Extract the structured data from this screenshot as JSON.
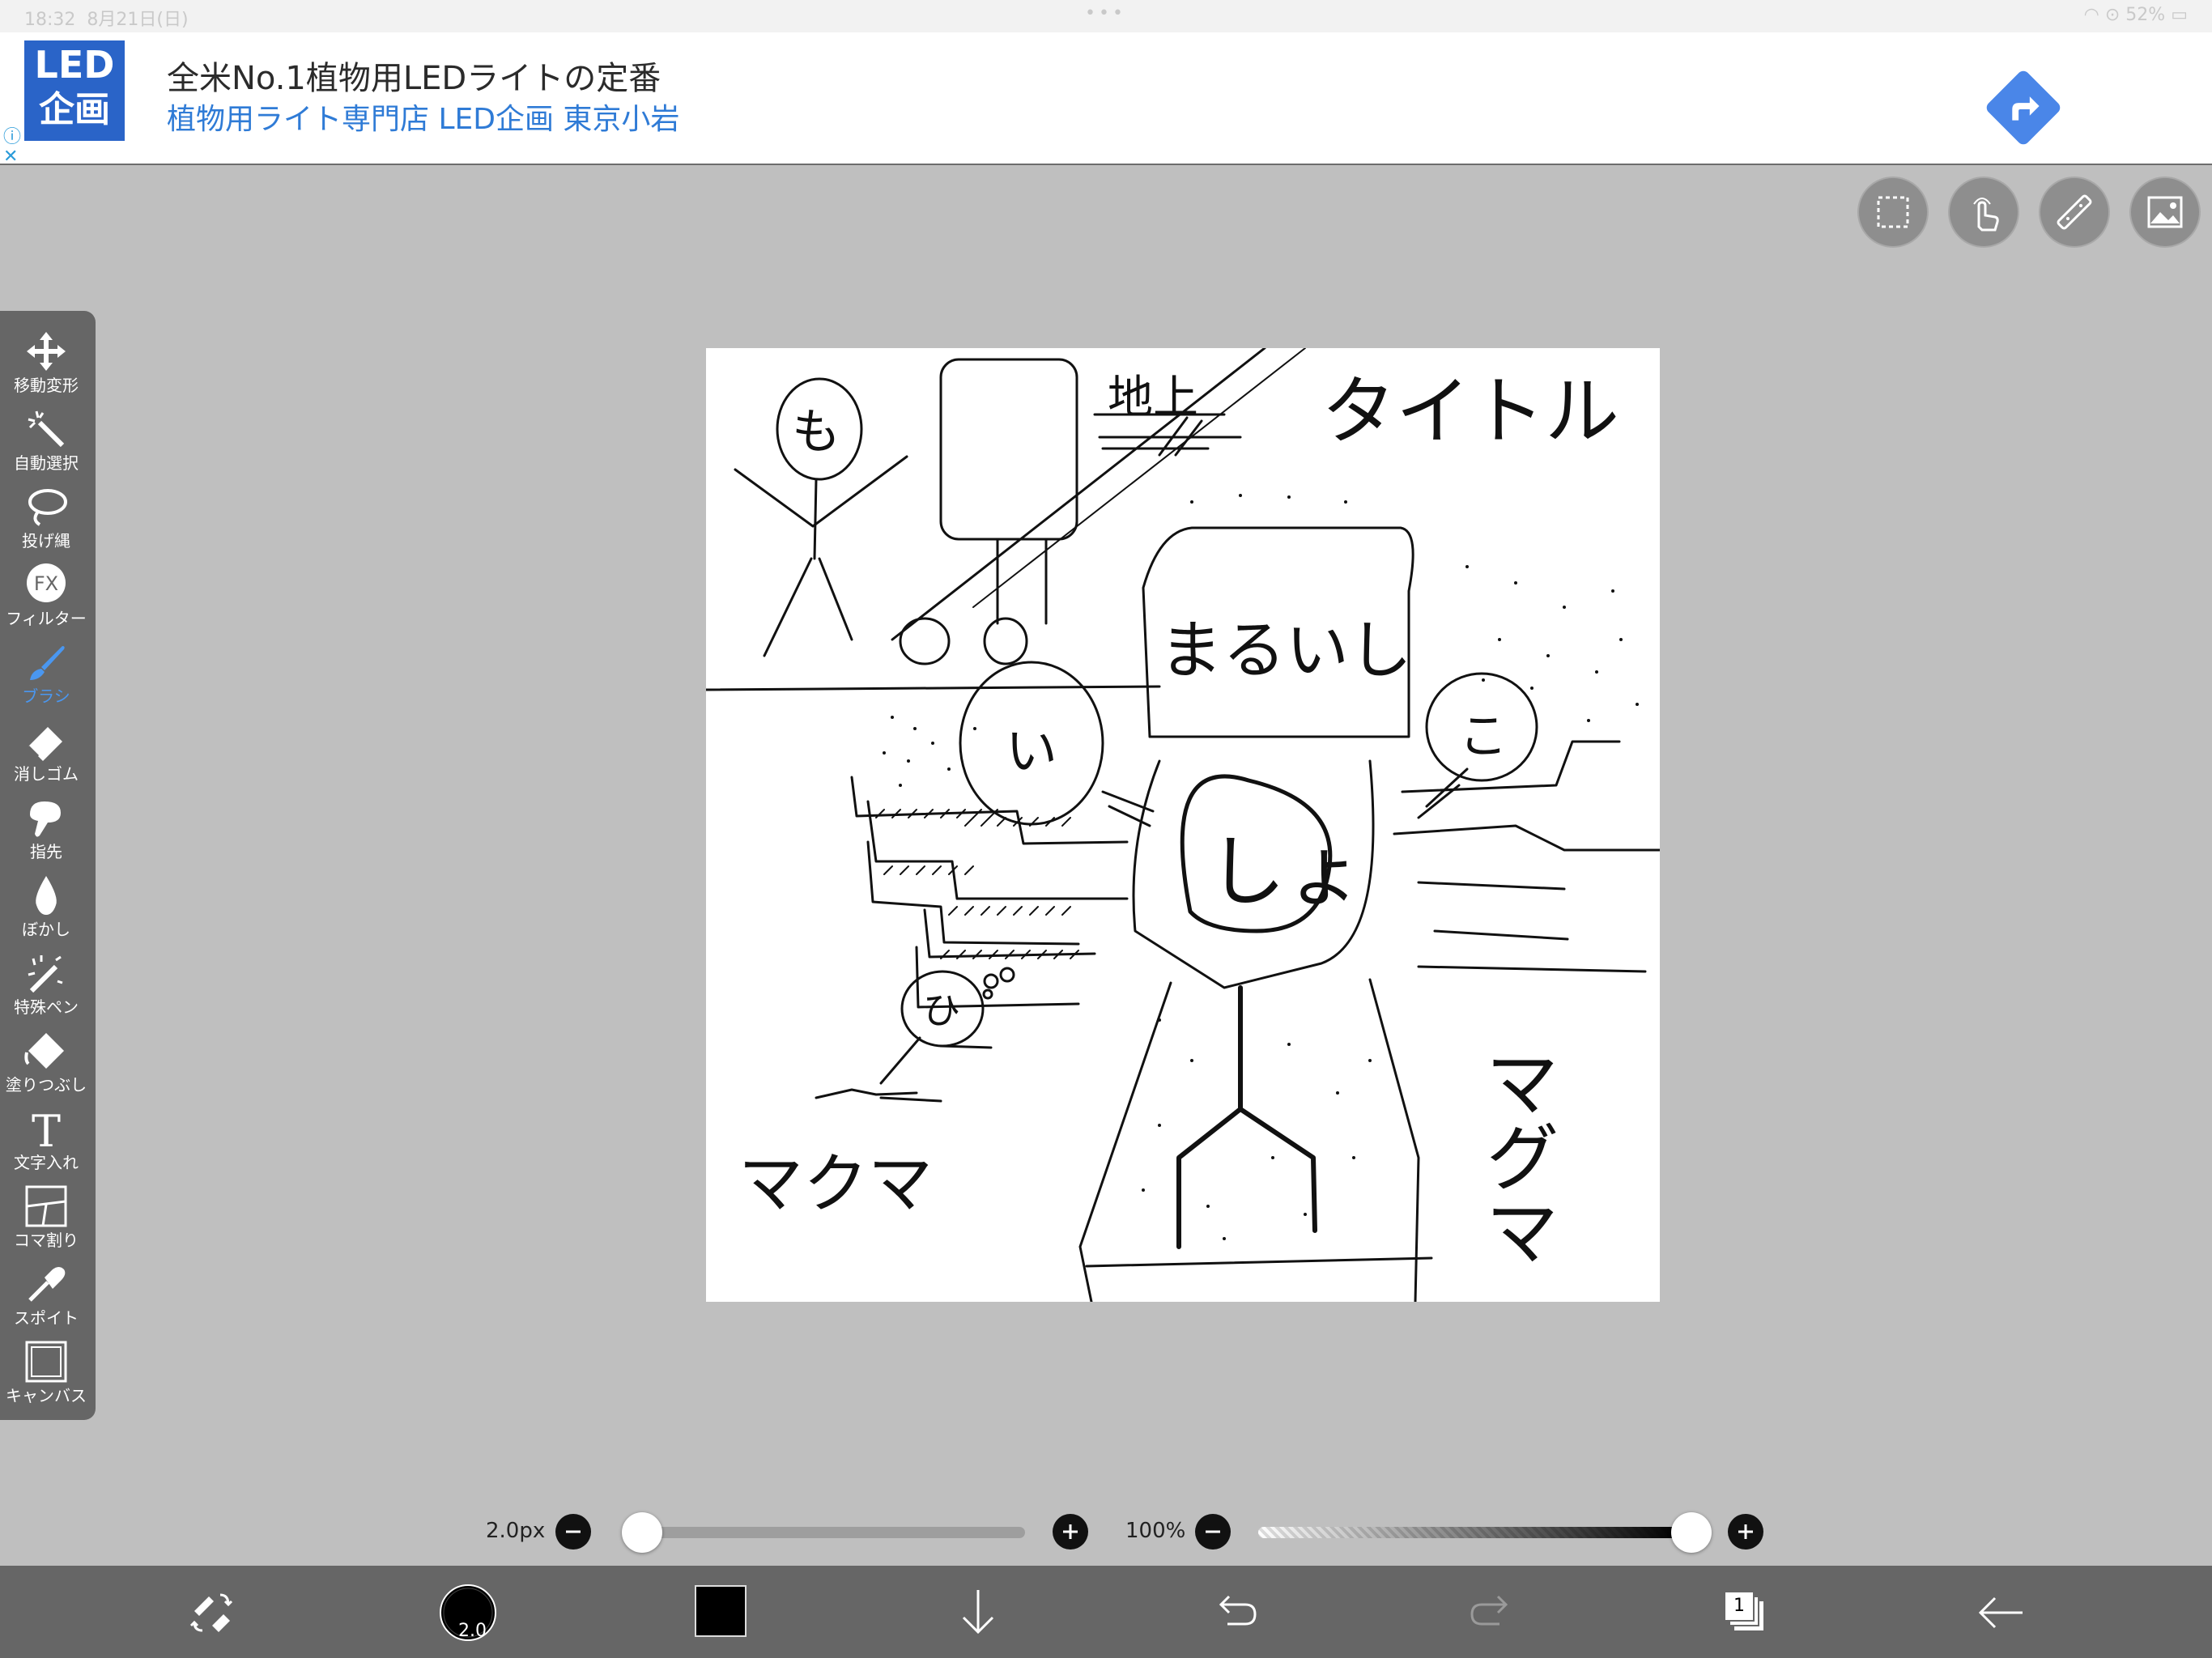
{
  "status_bar": {
    "time": "18:32",
    "date": "8月21日(日)",
    "battery": "52%"
  },
  "ad": {
    "logo_line1": "LED",
    "logo_line2": "企画",
    "title": "全米No.1植物用LEDライトの定番",
    "subtitle": "植物用ライト専門店 LED企画 東京小岩"
  },
  "top_tools": [
    "selection-icon",
    "touch-icon",
    "ruler-icon",
    "material-icon"
  ],
  "left_toolbar": [
    {
      "label": "移動変形",
      "icon": "move-icon"
    },
    {
      "label": "自動選択",
      "icon": "magic-wand-icon"
    },
    {
      "label": "投げ縄",
      "icon": "lasso-icon"
    },
    {
      "label": "フィルター",
      "icon": "fx-icon"
    },
    {
      "label": "ブラシ",
      "icon": "brush-icon",
      "active": true
    },
    {
      "label": "消しゴム",
      "icon": "eraser-icon"
    },
    {
      "label": "指先",
      "icon": "finger-icon"
    },
    {
      "label": "ぼかし",
      "icon": "blur-drop-icon"
    },
    {
      "label": "特殊ペン",
      "icon": "special-pen-icon"
    },
    {
      "label": "塗りつぶし",
      "icon": "bucket-icon"
    },
    {
      "label": "文字入れ",
      "icon": "text-icon"
    },
    {
      "label": "コマ割り",
      "icon": "frame-divide-icon"
    },
    {
      "label": "スポイト",
      "icon": "eyedropper-icon"
    },
    {
      "label": "キャンバス",
      "icon": "canvas-icon"
    }
  ],
  "canvas_drawing": {
    "texts": [
      "タイトル",
      "まるいし",
      "マクマ",
      "マグマ",
      "も",
      "しょ",
      "い",
      "こ",
      "ひ",
      "地上"
    ]
  },
  "brush": {
    "size_label": "2.0px",
    "size_fraction": 0.0,
    "opacity_label": "100%",
    "opacity_fraction": 1.0
  },
  "bottom_bar": {
    "brush_size_badge": "2.0",
    "color": "#000000",
    "layer_count": "1"
  },
  "colors": {
    "toolbar_bg": "#666666",
    "workspace_bg": "#bfbfbf",
    "accent": "#4a97f0",
    "ad_blue": "#2a64c8"
  }
}
